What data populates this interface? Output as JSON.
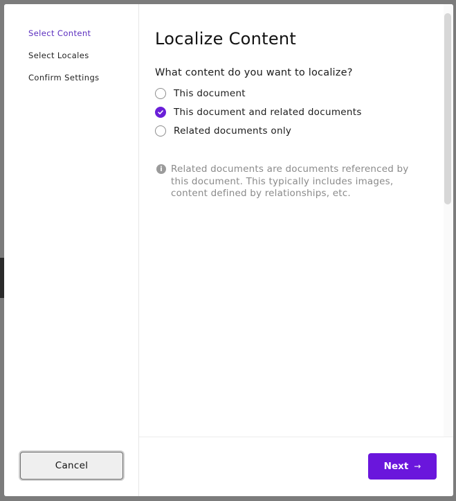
{
  "sidebar": {
    "steps": [
      {
        "label": "Select Content",
        "active": true
      },
      {
        "label": "Select Locales",
        "active": false
      },
      {
        "label": "Confirm Settings",
        "active": false
      }
    ],
    "cancel_label": "Cancel"
  },
  "main": {
    "title": "Localize Content",
    "question": "What content do you want to localize?",
    "options": [
      {
        "label": "This document",
        "checked": false
      },
      {
        "label": "This document and related documents",
        "checked": true
      },
      {
        "label": "Related documents only",
        "checked": false
      }
    ],
    "info_icon": "info-icon",
    "info_text": "Related documents are documents referenced by this document. This typically includes images, content defined by relationships, etc."
  },
  "footer": {
    "next_label": "Next",
    "next_icon": "arrow-right-icon"
  },
  "colors": {
    "accent": "#6a16dc",
    "active_step": "#5a2dbf",
    "info_text": "#8a8a8a"
  }
}
